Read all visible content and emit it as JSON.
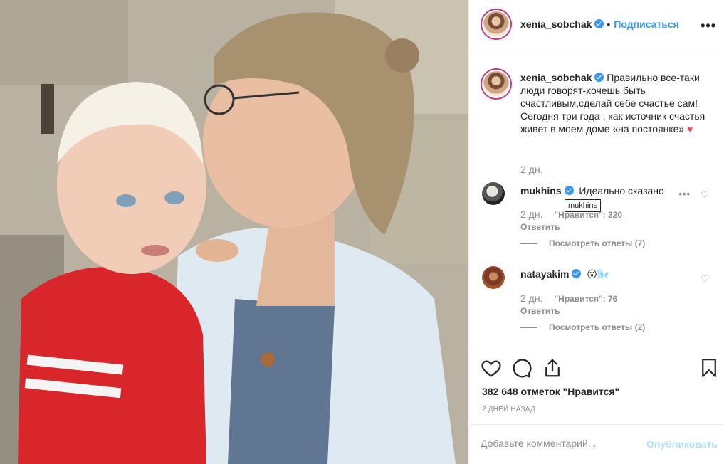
{
  "post": {
    "username": "xenia_sobchak",
    "follow_label": "Подписаться",
    "separator": "•",
    "more_icon": "more-horizontal-icon"
  },
  "caption": {
    "username": "xenia_sobchak",
    "text": "Правильно все-таки люди говорят-хочешь быть счастливым,сделай себе счастье сам! Сегодня три года , как источник счастья живет в моем доме «на постоянке»",
    "emoji": "♥",
    "time": "2 дн."
  },
  "comments": [
    {
      "username": "mukhins",
      "text": "Идеально сказано",
      "time": "2 дн.",
      "likes": "\"Нравится\": 320",
      "reply": "Ответить",
      "view_replies": "Посмотреть ответы (7)",
      "tooltip": "mukhins"
    },
    {
      "username": "natayakim",
      "text": "😮🌬️",
      "time": "2 дн.",
      "likes": "\"Нравится\": 76",
      "reply": "Ответить",
      "view_replies": "Посмотреть ответы (2)"
    }
  ],
  "actions": {
    "like_icon": "heart-outline-icon",
    "comment_icon": "comment-icon",
    "share_icon": "share-icon",
    "save_icon": "bookmark-icon"
  },
  "likes_count": "382 648 отметок \"Нравится\"",
  "posted_ago": "2 ДНЕЙ НАЗАД",
  "add_comment": {
    "placeholder": "Добавьте комментарий...",
    "publish_label": "Опубликовать"
  },
  "colors": {
    "accent": "#3897f0",
    "publish_disabled": "#b2dffc",
    "muted": "#8e8e8e",
    "text": "#262626",
    "heart": "#ed4956"
  }
}
